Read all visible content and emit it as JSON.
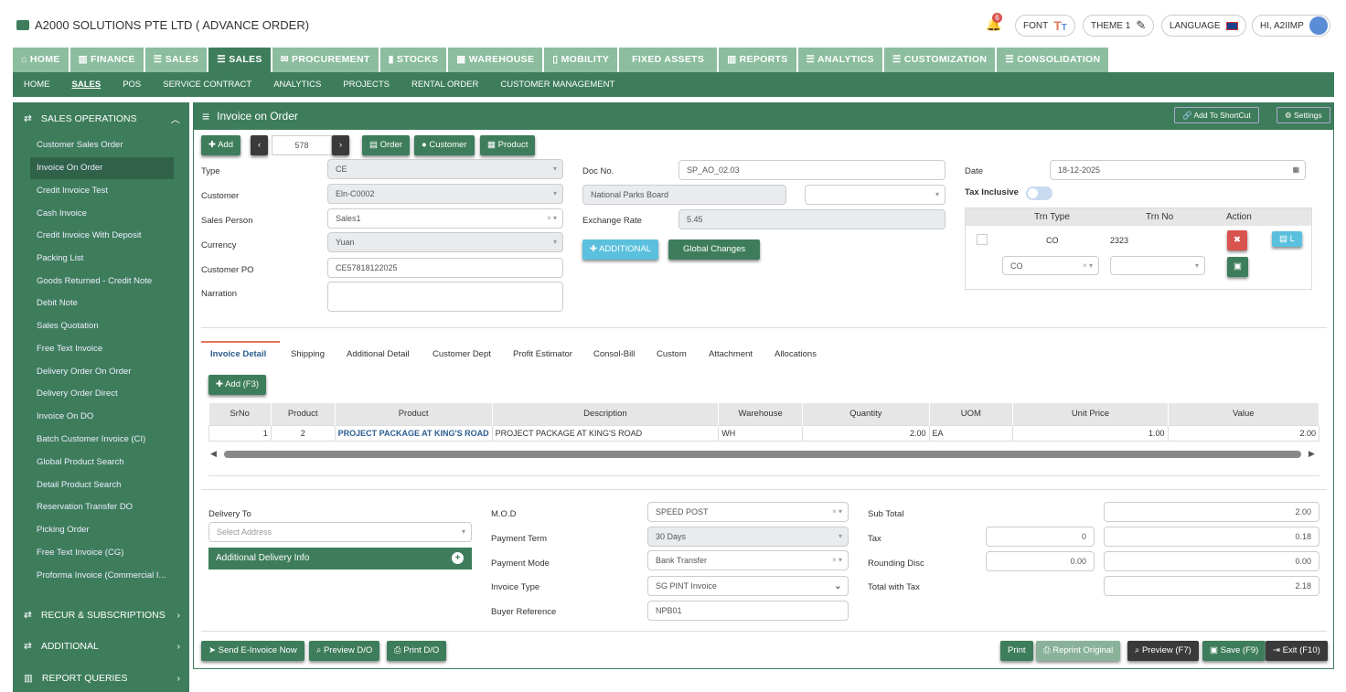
{
  "app": {
    "title": "A2000 SOLUTIONS PTE LTD ( ADVANCE ORDER)",
    "notif_count": "6",
    "font_label": "FONT",
    "theme_label": "THEME 1",
    "language_label": "LANGUAGE",
    "user_label": "HI, A2IIMP"
  },
  "mainnav": [
    "HOME",
    "FINANCE",
    "SALES",
    "SALES",
    "PROCUREMENT",
    "STOCKS",
    "WAREHOUSE",
    "MOBILITY",
    "FIXED ASSETS",
    "REPORTS",
    "ANALYTICS",
    "CUSTOMIZATION",
    "CONSOLIDATION"
  ],
  "mainnav_icons": [
    "⌂",
    "▥",
    "☰",
    "☰",
    "✉",
    "▮",
    "▦",
    "▯",
    "",
    "▥",
    "☰",
    "☰",
    "☰"
  ],
  "subnav": [
    "HOME",
    "SALES",
    "POS",
    "SERVICE CONTRACT",
    "ANALYTICS",
    "PROJECTS",
    "RENTAL ORDER",
    "CUSTOMER MANAGEMENT"
  ],
  "sidebar": {
    "section1": "SALES OPERATIONS",
    "items": [
      "Customer Sales Order",
      "Invoice On Order",
      "Credit Invoice Test",
      "Cash Invoice",
      "Credit Invoice With Deposit",
      "Packing List",
      "Goods Returned - Credit Note",
      "Debit Note",
      "Sales Quotation",
      "Free Text Invoice",
      "Delivery Order On Order",
      "Delivery Order Direct",
      "Invoice On DO",
      "Batch Customer Invoice (CI)",
      "Global Product Search",
      "Detail Product Search",
      "Reservation Transfer DO",
      "Picking Order",
      "Free Text Invoice (CG)",
      "Proforma Invoice (Commercial I..."
    ],
    "section2": "RECUR & SUBSCRIPTIONS",
    "section3": "ADDITIONAL",
    "section4": "REPORT QUERIES"
  },
  "panel": {
    "title": "Invoice on Order",
    "shortcut": "Add To ShortCut",
    "settings": "Settings"
  },
  "toolbar": {
    "add": "Add",
    "record_no": "578",
    "order": "Order",
    "customer": "Customer",
    "product": "Product"
  },
  "form": {
    "type_label": "Type",
    "type_val": "CE",
    "customer_label": "Customer",
    "customer_val": "Eln-C0002",
    "salesperson_label": "Sales Person",
    "salesperson_val": "Sales1",
    "currency_label": "Currency",
    "currency_val": "Yuan",
    "custpo_label": "Customer PO",
    "custpo_val": "CE57818122025",
    "narration_label": "Narration",
    "docno_label": "Doc No.",
    "docno_val": "SP_AO_02.03",
    "custname_val": "National Parks Board",
    "exrate_label": "Exchange Rate",
    "exrate_val": "5.45",
    "additional_btn": "ADDITIONAL",
    "global_btn": "Global Changes",
    "date_label": "Date",
    "date_val": "18-12-2025",
    "taxinc_label": "Tax Inclusive"
  },
  "trn": {
    "headers": [
      "Trn Type",
      "Trn No",
      "Action"
    ],
    "row_type": "CO",
    "row_no": "2323",
    "select_val": "CO",
    "l_btn": "L"
  },
  "tabs": [
    "Invoice Detail",
    "Shipping",
    "Additional Detail",
    "Customer Dept",
    "Profit Estimator",
    "Consol-Bill",
    "Custom",
    "Attachment",
    "Allocations"
  ],
  "detail": {
    "add_btn": "Add (F3)",
    "headers": [
      "SrNo",
      "Product",
      "Product",
      "Description",
      "Warehouse",
      "Quantity",
      "UOM",
      "Unit Price",
      "Value"
    ],
    "row": [
      "1",
      "2",
      "PROJECT PACKAGE AT KING'S ROAD",
      "PROJECT PACKAGE AT KING'S ROAD",
      "WH",
      "2.00",
      "EA",
      "1.00",
      "2.00"
    ]
  },
  "bottom": {
    "delivery_label": "Delivery To",
    "delivery_ph": "Select Address",
    "adddelivery": "Additional Delivery Info",
    "mod_label": "M.O.D",
    "mod_val": "SPEED POST",
    "payterm_label": "Payment Term",
    "payterm_val": "30 Days",
    "paymode_label": "Payment Mode",
    "paymode_val": "Bank Transfer",
    "invtype_label": "Invoice Type",
    "invtype_val": "SG PINT Invoice",
    "buyerref_label": "Buyer Reference",
    "buyerref_val": "NPB01",
    "subtotal_label": "Sub Total",
    "subtotal_val": "2.00",
    "tax_label": "Tax",
    "tax_pct": "0",
    "tax_val": "0.18",
    "round_label": "Rounding Disc",
    "round_in": "0.00",
    "round_val": "0.00",
    "total_label": "Total with Tax",
    "total_val": "2.18"
  },
  "footer": {
    "einvoice": "Send E-Invoice Now",
    "preview_do": "Preview D/O",
    "print_do": "Print D/O",
    "print": "Print",
    "reprint": "Reprint Original",
    "preview": "Preview (F7)",
    "save": "Save (F9)",
    "exit": "Exit (F10)"
  }
}
